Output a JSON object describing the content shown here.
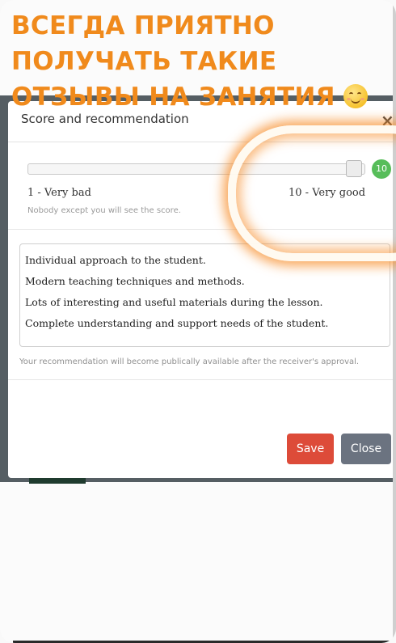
{
  "caption": {
    "lines": [
      "ВСЕГДА ПРИЯТНО",
      "ПОЛУЧАТЬ ТАКИЕ",
      "ОТЗЫВЫ НА ЗАНЯТИЯ"
    ],
    "color": "#f08a1c",
    "emoji": "smiling-face-icon"
  },
  "modal": {
    "title": "Score and recommendation",
    "close_symbol": "×",
    "slider": {
      "min_label": "1 - Very bad",
      "max_label": "10 - Very good",
      "value": "10",
      "badge_color": "#57bd5a",
      "privacy_note": "Nobody except you will see the score."
    },
    "recommendation": {
      "lines": [
        "Individual approach to the student.",
        "Modern teaching techniques and methods.",
        "Lots of interesting and useful materials  during the lesson.",
        "Complete understanding and support  needs of the student."
      ],
      "note": "Your recommendation will become publically available after the receiver's approval."
    },
    "buttons": {
      "save": "Save",
      "close": "Close",
      "save_color": "#dd4b39",
      "close_color": "#6b7380"
    }
  }
}
